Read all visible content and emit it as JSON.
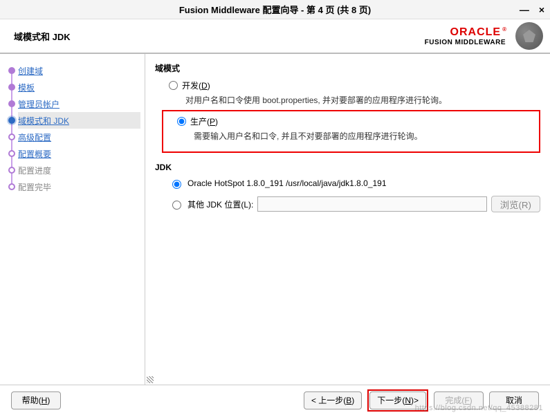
{
  "window": {
    "title": "Fusion Middleware 配置向导 - 第 4 页 (共 8 页)"
  },
  "header": {
    "page_title": "域模式和 JDK",
    "brand_name": "ORACLE",
    "brand_sub": "FUSION MIDDLEWARE"
  },
  "sidebar": {
    "steps": [
      {
        "label": "创建域",
        "state": "done",
        "link": true
      },
      {
        "label": "模板",
        "state": "done",
        "link": true
      },
      {
        "label": "管理员帐户",
        "state": "done",
        "link": true
      },
      {
        "label": "域模式和 JDK",
        "state": "current",
        "link": true
      },
      {
        "label": "高级配置",
        "state": "future",
        "link": true
      },
      {
        "label": "配置概要",
        "state": "future",
        "link": true
      },
      {
        "label": "配置进度",
        "state": "disabled",
        "link": false
      },
      {
        "label": "配置完毕",
        "state": "disabled",
        "link": false
      }
    ]
  },
  "main": {
    "domain_mode_title": "域模式",
    "dev_label": "开发",
    "dev_mn": "D",
    "dev_desc": "对用户名和口令使用 boot.properties, 并对要部署的应用程序进行轮询。",
    "prod_label": "生产",
    "prod_mn": "P",
    "prod_desc": "需要输入用户名和口令, 并且不对要部署的应用程序进行轮询。",
    "jdk_title": "JDK",
    "jdk_opt1_prefix": "O",
    "jdk_opt1_label": "racle HotSpot 1.8.0_191 /usr/local/java/jdk1.8.0_191",
    "jdk_opt2_label": "其他 JDK 位置",
    "jdk_opt2_mn": "L",
    "jdk_path_value": "",
    "browse_label": "浏览",
    "browse_mn": "R"
  },
  "footer": {
    "help": "帮助",
    "help_mn": "H",
    "back": "< 上一步",
    "back_mn": "B",
    "next": "下一步",
    "next_mn": "N",
    "next_suffix": ">",
    "finish": "完成",
    "finish_mn": "F",
    "cancel": "取消"
  },
  "watermark": "https://blog.csdn.net/qq_45388281"
}
